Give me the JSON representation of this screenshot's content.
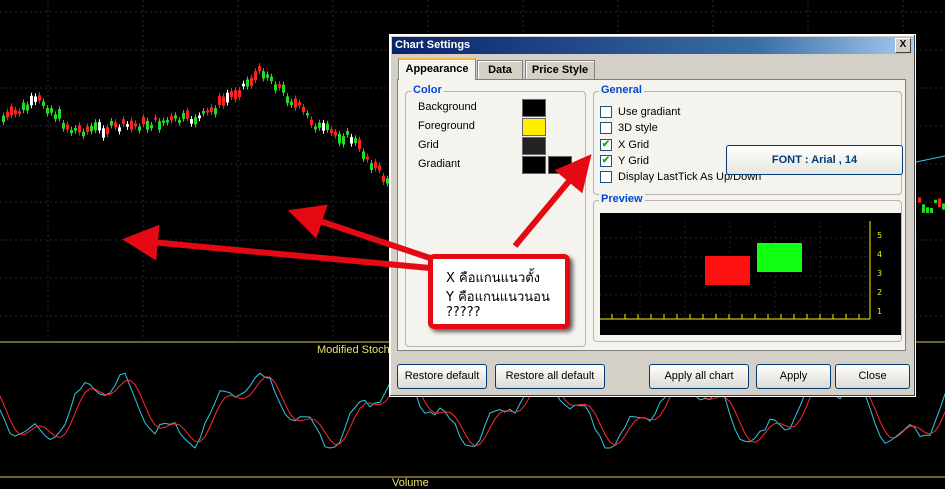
{
  "background": {
    "indicator_label": "Modified Stoch",
    "volume_label": "Volume",
    "colors": {
      "up_candle": "#22dd22",
      "down_candle": "#ff2222",
      "doji": "#ffffff",
      "separator": "#d8c84a",
      "stoch_fast": "#33c6e6",
      "stoch_slow": "#ff2a2a"
    }
  },
  "dialog": {
    "title": "Chart Settings",
    "close_glyph": "X",
    "tabs": [
      {
        "label": "Appearance",
        "active": true
      },
      {
        "label": "Data",
        "active": false
      },
      {
        "label": "Price Style",
        "active": false
      }
    ],
    "color_group": {
      "title": "Color",
      "rows": [
        {
          "label": "Background",
          "swatches": [
            "#000000"
          ]
        },
        {
          "label": "Foreground",
          "swatches": [
            "#ffee00"
          ]
        },
        {
          "label": "Grid",
          "swatches": [
            "#222222"
          ]
        },
        {
          "label": "Gradiant",
          "swatches": [
            "#000000",
            "#000000"
          ]
        }
      ]
    },
    "general_group": {
      "title": "General",
      "options": [
        {
          "label": "Use gradiant",
          "checked": false
        },
        {
          "label": "3D style",
          "checked": false
        },
        {
          "label": "X Grid",
          "checked": true
        },
        {
          "label": "Y Grid",
          "checked": true
        },
        {
          "label": "Display LastTick As Up/Down",
          "checked": false
        }
      ],
      "font_button": "FONT : Arial , 14"
    },
    "preview_group": {
      "title": "Preview",
      "y_ticks": [
        "5",
        "4",
        "3",
        "2",
        "1"
      ],
      "down_color": "#ff1111",
      "up_color": "#11ff11"
    },
    "buttons": {
      "restore_default": "Restore default",
      "restore_all_default": "Restore all default",
      "apply_all_chart": "Apply all chart",
      "apply": "Apply",
      "close": "Close"
    }
  },
  "annotation": {
    "lines": [
      "X คือแกนแนวตั้ง",
      "Y คือแกนแนวนอน",
      "?????"
    ],
    "color": "#e50914"
  }
}
